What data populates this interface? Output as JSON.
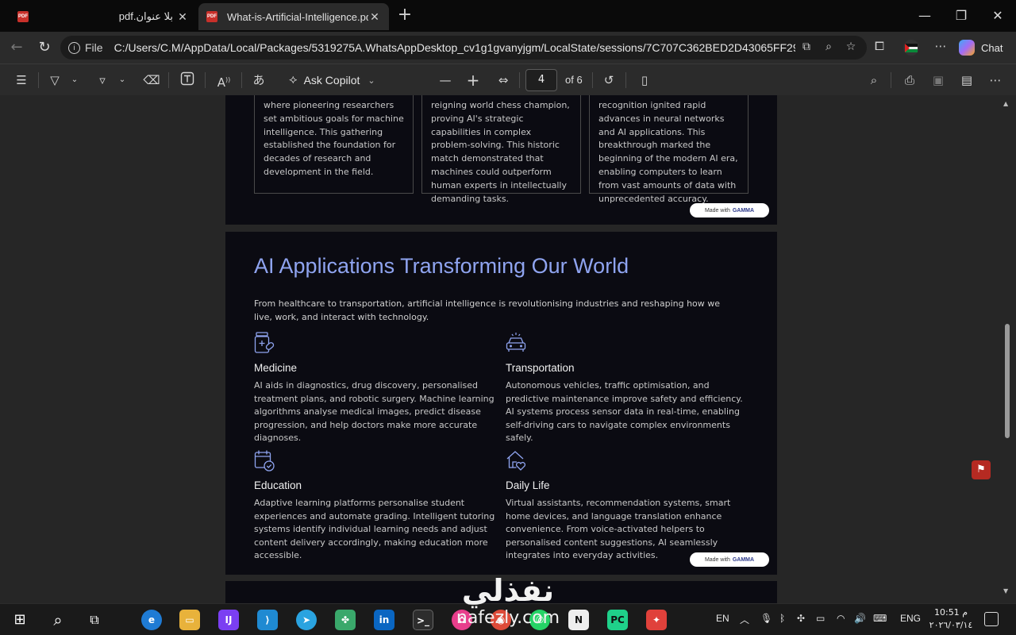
{
  "browser": {
    "tabs": [
      {
        "title": "بلا عنوان.pdf",
        "active": false
      },
      {
        "title": "What-is-Artificial-Intelligence.pdf",
        "active": true
      }
    ],
    "address": {
      "scheme_label": "File",
      "url": "C:/Users/C.M/AppData/Local/Packages/5319275A.WhatsAppDesktop_cv1g1gvanyjgm/LocalState/sessions/7C707C362BED2D43065FF29A..."
    },
    "chat_label": "Chat"
  },
  "pdf_toolbar": {
    "ask_copilot": "Ask Copilot",
    "current_page": "4",
    "page_of": "of 6"
  },
  "page1": {
    "cards": [
      "where pioneering researchers set ambitious goals for machine intelligence. This gathering established the foundation for decades of research and development in the field.",
      "reigning world chess champion, proving AI's strategic capabilities in complex problem-solving. This historic match demonstrated that machines could outperform human experts in intellectually demanding tasks.",
      "recognition ignited rapid advances in neural networks and AI applications. This breakthrough marked the beginning of the modern AI era, enabling computers to learn from vast amounts of data with unprecedented accuracy."
    ]
  },
  "made_with": {
    "prefix": "Made with",
    "brand": "GAMMA"
  },
  "page2": {
    "title": "AI Applications Transforming Our World",
    "intro": "From healthcare to transportation, artificial intelligence is revolutionising industries and reshaping how we live, work, and interact with technology.",
    "features": [
      {
        "title": "Medicine",
        "desc": "AI aids in diagnostics, drug discovery, personalised treatment plans, and robotic surgery. Machine learning algorithms analyse medical images, predict disease progression, and help doctors make more accurate diagnoses."
      },
      {
        "title": "Transportation",
        "desc": "Autonomous vehicles, traffic optimisation, and predictive maintenance improve safety and efficiency. AI systems process sensor data in real-time, enabling self-driving cars to navigate complex environments safely."
      },
      {
        "title": "Education",
        "desc": "Adaptive learning platforms personalise student experiences and automate grading. Intelligent tutoring systems identify individual learning needs and adjust content delivery accordingly, making education more accessible."
      },
      {
        "title": "Daily Life",
        "desc": "Virtual assistants, recommendation systems, smart home devices, and language translation enhance convenience. From voice-activated helpers to personalised content suggestions, AI seamlessly integrates into everyday activities."
      }
    ]
  },
  "taskbar": {
    "lang_short": "EN",
    "lang": "ENG",
    "time": "10:51 م",
    "date": "٢٠٢٦/٠٣/١٤"
  },
  "watermark": {
    "arabic": "نفذلي",
    "latin": "nafezly.com"
  },
  "colors": {
    "accent_title": "#8fa4f0",
    "page_bg": "#0b0b12",
    "pdf_red": "#c8302a"
  }
}
